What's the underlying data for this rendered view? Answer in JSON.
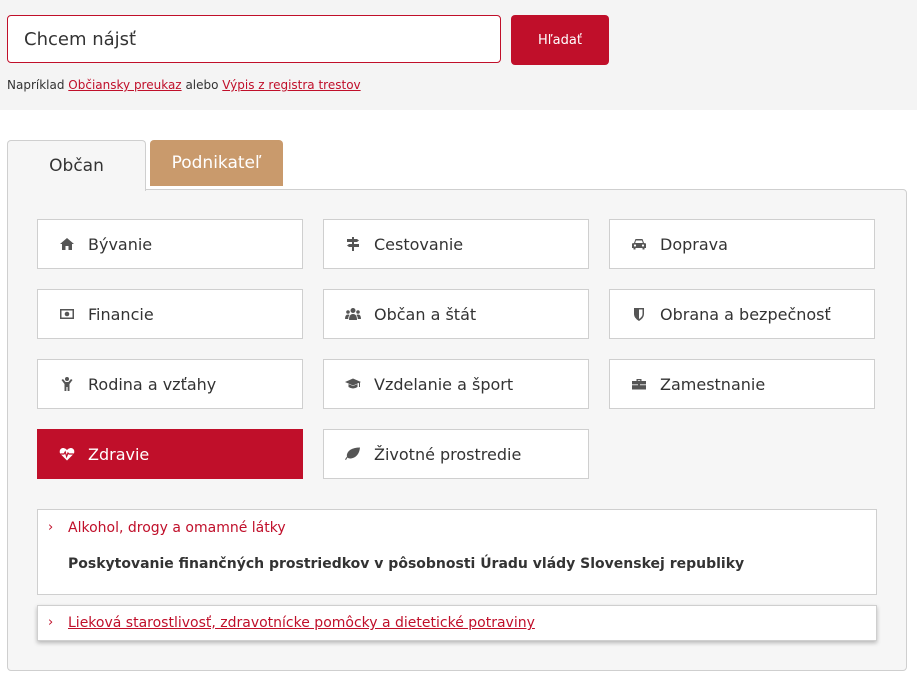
{
  "search": {
    "placeholder": "Chcem nájsť",
    "button_label": "Hľadať",
    "hint_prefix": "Napríklad",
    "hint_link1": "Občiansky preukaz",
    "hint_middle": "alebo",
    "hint_link2": "Výpis z registra trestov"
  },
  "tabs": [
    {
      "label": "Občan",
      "active": true
    },
    {
      "label": "Podnikateľ",
      "active": false
    }
  ],
  "categories": [
    {
      "label": "Bývanie",
      "icon": "home-icon"
    },
    {
      "label": "Cestovanie",
      "icon": "signpost-icon"
    },
    {
      "label": "Doprava",
      "icon": "car-icon"
    },
    {
      "label": "Financie",
      "icon": "money-icon"
    },
    {
      "label": "Občan a štát",
      "icon": "users-icon"
    },
    {
      "label": "Obrana a bezpečnosť",
      "icon": "shield-icon"
    },
    {
      "label": "Rodina a vzťahy",
      "icon": "child-icon"
    },
    {
      "label": "Vzdelanie a šport",
      "icon": "graduation-cap-icon"
    },
    {
      "label": "Zamestnanie",
      "icon": "briefcase-icon"
    },
    {
      "label": "Zdravie",
      "icon": "heartbeat-icon",
      "active": true
    },
    {
      "label": "Životné prostredie",
      "icon": "leaf-icon"
    }
  ],
  "subcategories": [
    {
      "chevron": "›",
      "label": "Alkohol, drogy a omamné látky",
      "item": "Poskytovanie finančných prostriedkov v pôsobnosti Úradu vlády Slovenskej republiky"
    },
    {
      "chevron": "›",
      "label": "Lieková starostlivosť, zdravotnícke pomôcky a dietetické potraviny"
    }
  ],
  "colors": {
    "accent": "#c00f2a",
    "tab_secondary": "#c99a6c"
  }
}
